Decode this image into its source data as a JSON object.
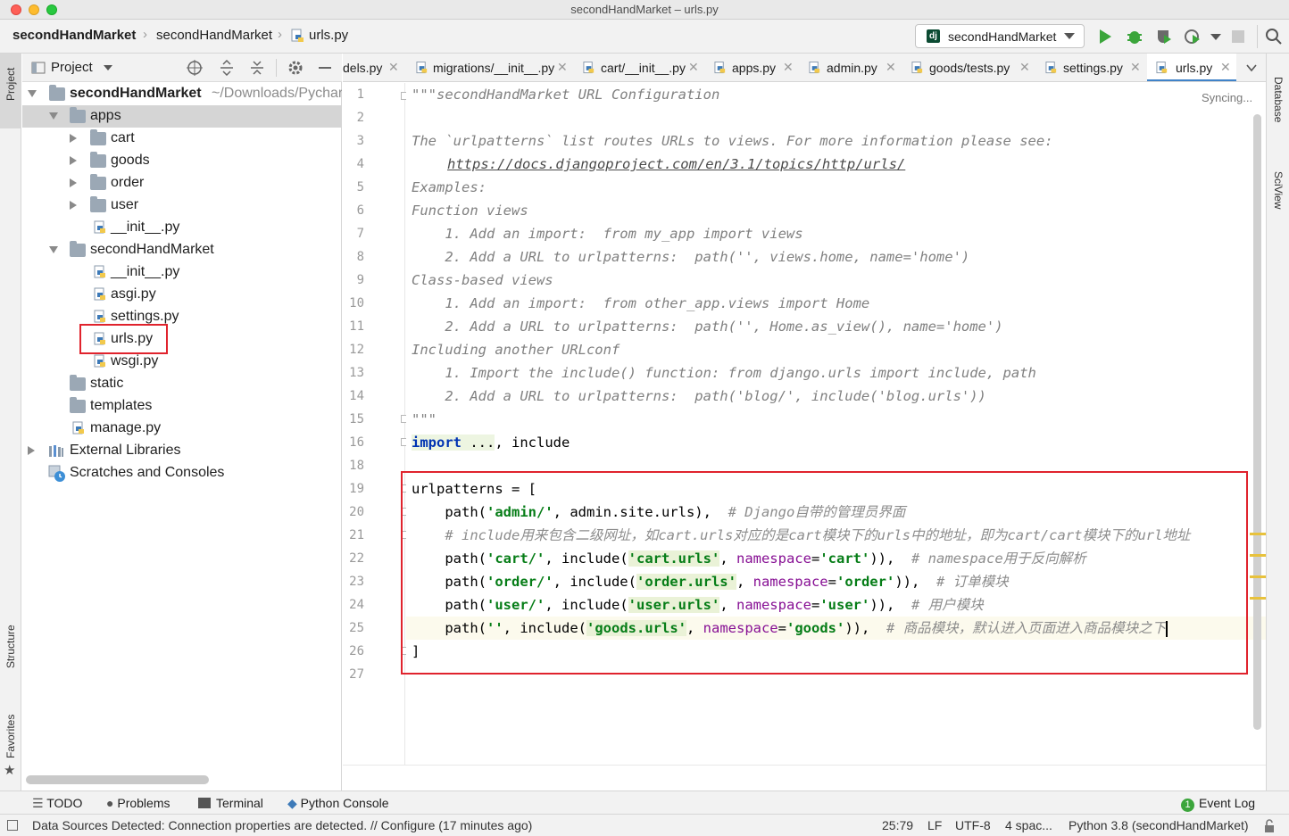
{
  "window": {
    "title": "secondHandMarket – urls.py"
  },
  "breadcrumb": [
    "secondHandMarket",
    "secondHandMarket",
    "urls.py"
  ],
  "run_config": {
    "label": "secondHandMarket"
  },
  "left_strip": {
    "project": "Project",
    "structure": "Structure",
    "favorites": "Favorites"
  },
  "right_strip": {
    "database": "Database",
    "sciview": "SciView"
  },
  "project_panel": {
    "title": "Project",
    "tree": [
      {
        "label": "secondHandMarket",
        "suffix": "~/Downloads/Pycharm",
        "type": "root"
      },
      {
        "label": "apps",
        "type": "folder"
      },
      {
        "label": "cart",
        "type": "folder"
      },
      {
        "label": "goods",
        "type": "folder"
      },
      {
        "label": "order",
        "type": "folder"
      },
      {
        "label": "user",
        "type": "folder"
      },
      {
        "label": "__init__.py",
        "type": "py"
      },
      {
        "label": "secondHandMarket",
        "type": "folder"
      },
      {
        "label": "__init__.py",
        "type": "py"
      },
      {
        "label": "asgi.py",
        "type": "py"
      },
      {
        "label": "settings.py",
        "type": "py"
      },
      {
        "label": "urls.py",
        "type": "py"
      },
      {
        "label": "wsgi.py",
        "type": "py"
      },
      {
        "label": "static",
        "type": "folder"
      },
      {
        "label": "templates",
        "type": "folder"
      },
      {
        "label": "manage.py",
        "type": "py"
      },
      {
        "label": "External Libraries",
        "type": "lib"
      },
      {
        "label": "Scratches and Consoles",
        "type": "scratch"
      }
    ]
  },
  "tabs": [
    {
      "label": "dels.py"
    },
    {
      "label": "migrations/__init__.py"
    },
    {
      "label": "cart/__init__.py"
    },
    {
      "label": "apps.py"
    },
    {
      "label": "admin.py"
    },
    {
      "label": "goods/tests.py"
    },
    {
      "label": "settings.py"
    },
    {
      "label": "urls.py",
      "active": true
    }
  ],
  "editor": {
    "syncing": "Syncing...",
    "line_numbers": [
      "1",
      "2",
      "3",
      "4",
      "5",
      "6",
      "7",
      "8",
      "9",
      "10",
      "11",
      "12",
      "13",
      "14",
      "15",
      "16",
      "18",
      "19",
      "20",
      "21",
      "22",
      "23",
      "24",
      "25",
      "26",
      "27"
    ],
    "code": {
      "l1": "\"\"\"secondHandMarket URL Configuration",
      "l3": "The `urlpatterns` list routes URLs to views. For more information please see:",
      "l4": "https://docs.djangoproject.com/en/3.1/topics/http/urls/",
      "l5": "Examples:",
      "l6": "Function views",
      "l7": "    1. Add an import:  from my_app import views",
      "l8": "    2. Add a URL to urlpatterns:  path('', views.home, name='home')",
      "l9": "Class-based views",
      "l10": "    1. Add an import:  from other_app.views import Home",
      "l11": "    2. Add a URL to urlpatterns:  path('', Home.as_view(), name='home')",
      "l12": "Including another URLconf",
      "l13": "    1. Import the include() function: from django.urls import include, path",
      "l14": "    2. Add a URL to urlpatterns:  path('blog/', include('blog.urls'))",
      "l15": "\"\"\"",
      "l16_kw": "import",
      "l16_fold": " ...",
      "l16_rest": ", include",
      "l19": "urlpatterns = [",
      "l20_a": "    path(",
      "l20_s": "'admin/'",
      "l20_b": ", admin.site.urls),  ",
      "l20_c": "# Django自带的管理员界面",
      "l21_c": "    # include用来包含二级网址，如cart.urls对应的是cart模块下的urls中的地址，即为cart/cart模块下的url地址",
      "l22_a": "    path(",
      "l22_s1": "'cart/'",
      "l22_b": ", include(",
      "l22_s2": "'cart.urls'",
      "l22_c": ", ",
      "l22_p": "namespace",
      "l22_d": "=",
      "l22_s3": "'cart'",
      "l22_e": ")),  ",
      "l22_cm": "# namespace用于反向解析",
      "l23_s1": "'order/'",
      "l23_s2": "'order.urls'",
      "l23_s3": "'order'",
      "l23_cm": "# 订单模块",
      "l24_s1": "'user/'",
      "l24_s2": "'user.urls'",
      "l24_s3": "'user'",
      "l24_cm": "# 用户模块",
      "l25_s1": "''",
      "l25_s2": "'goods.urls'",
      "l25_s3": "'goods'",
      "l25_cm": "# 商品模块，默认进入页面进入商品模块之下",
      "l26": "]"
    }
  },
  "bottom_tools": {
    "todo": "TODO",
    "problems": "Problems",
    "terminal": "Terminal",
    "python_console": "Python Console",
    "event_log": "Event Log",
    "event_count": "1"
  },
  "status": {
    "message": "Data Sources Detected: Connection properties are detected. // Configure (17 minutes ago)",
    "position": "25:79",
    "line_sep": "LF",
    "encoding": "UTF-8",
    "indent": "4 spac...",
    "interpreter": "Python 3.8 (secondHandMarket)"
  },
  "colors": {
    "accent": "#4083c9",
    "highlight_box": "#e0232d",
    "string": "#067d17",
    "keyword": "#0033b3"
  }
}
